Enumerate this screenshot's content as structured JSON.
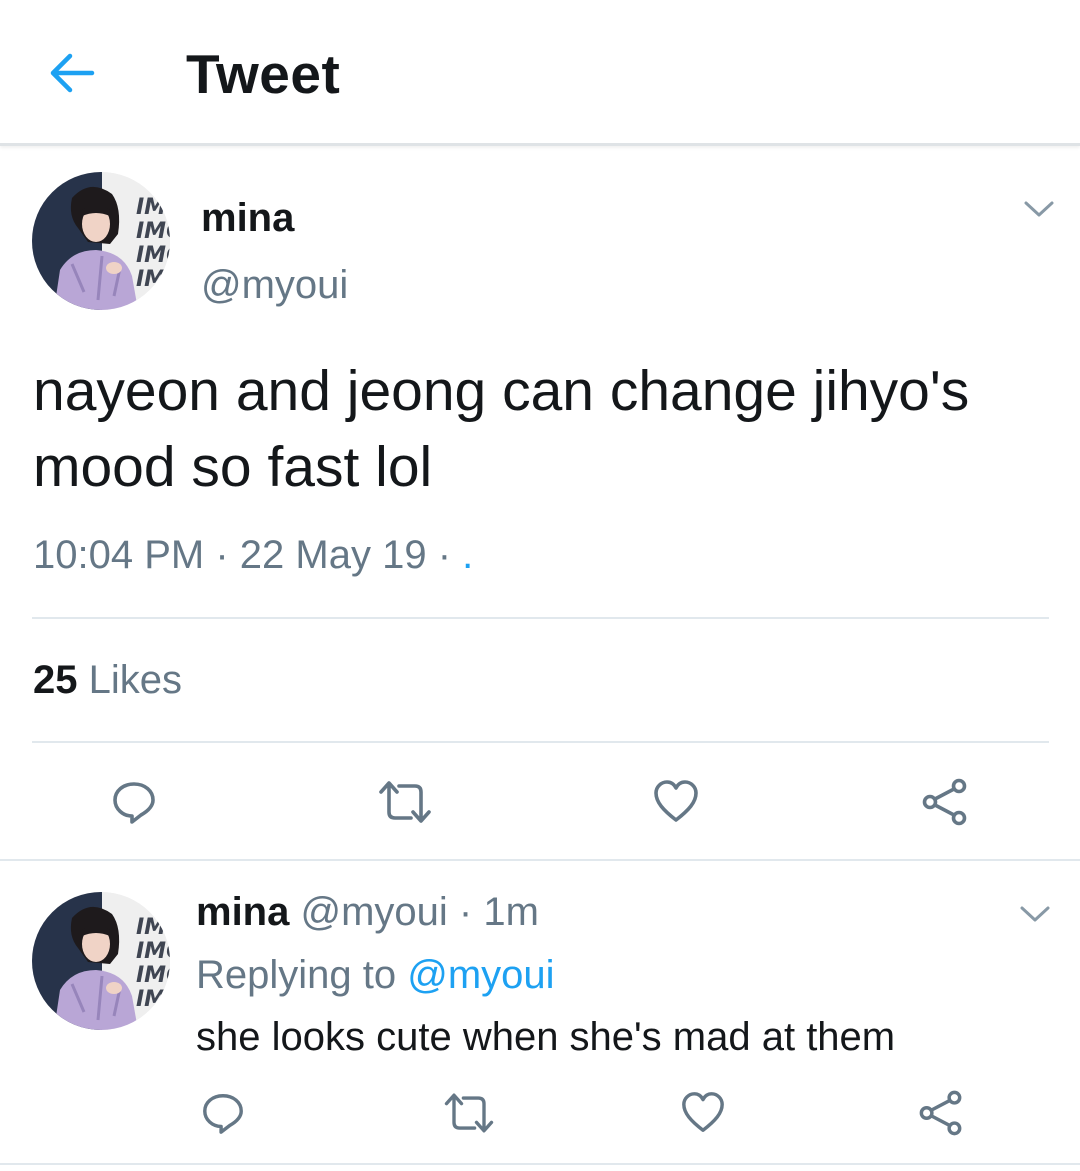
{
  "header": {
    "title": "Tweet"
  },
  "tweet": {
    "name": "mina",
    "handle": "@myoui",
    "text": "nayeon and jeong can change jihyo's mood so fast lol",
    "time": "10:04 PM",
    "date": "22 May 19",
    "sep": "·",
    "trailing_link": ".",
    "likes_count": "25",
    "likes_label": "Likes"
  },
  "reply": {
    "name": "mina",
    "handle": "@myoui",
    "sep": "·",
    "age": "1m",
    "replying_prefix": "Replying to",
    "replying_to": "@myoui",
    "text": "she looks cute when she's mad at them"
  },
  "colors": {
    "accent": "#1da1f2",
    "text_primary": "#14171a",
    "text_secondary": "#657786",
    "divider": "#e1e8ed"
  },
  "avatar_text": "IMG",
  "icons": {
    "back": "arrow-left-icon",
    "caret": "chevron-down-icon",
    "reply": "reply-icon",
    "retweet": "retweet-icon",
    "like": "heart-icon",
    "share": "share-icon"
  }
}
